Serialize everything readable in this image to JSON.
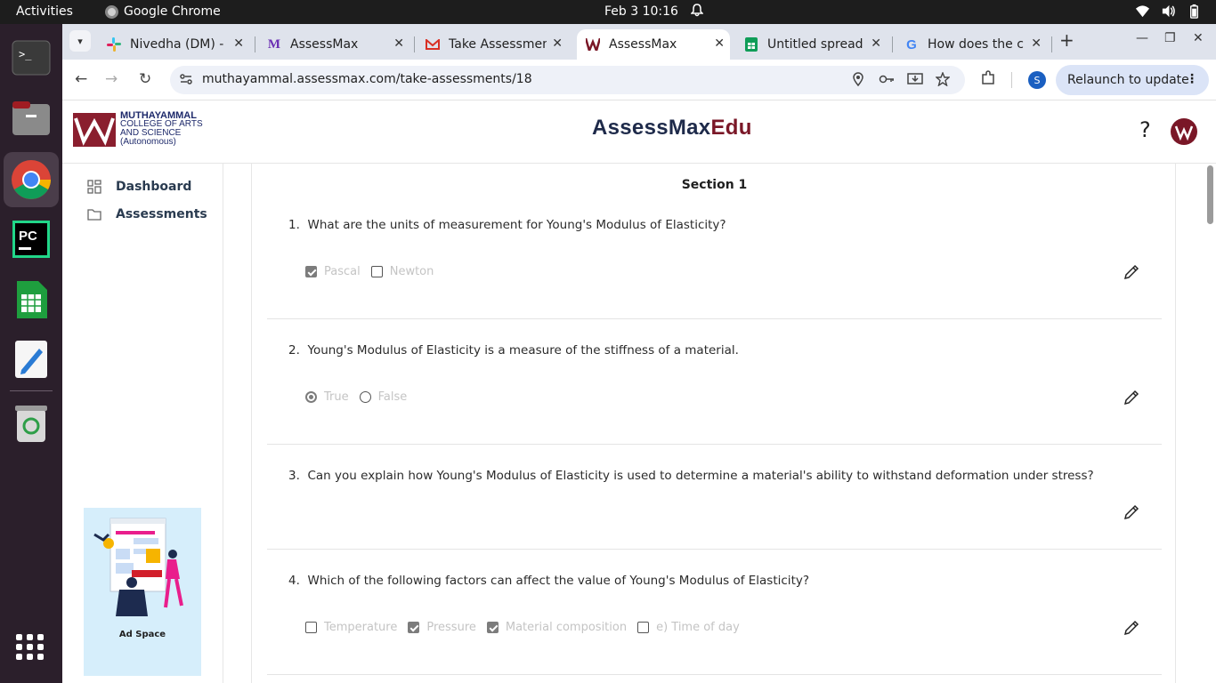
{
  "topbar": {
    "activities": "Activities",
    "app_name": "Google Chrome",
    "clock": "Feb 3  10:16"
  },
  "dock": {
    "apps": [
      "terminal-icon",
      "files-icon",
      "chrome-icon",
      "pycharm-icon",
      "spreadsheet-icon",
      "text-editor-icon",
      "trash-icon"
    ]
  },
  "tabs": [
    {
      "label": "Nivedha (DM) - y",
      "icon": "slack-icon",
      "active": false
    },
    {
      "label": "AssessMax",
      "icon": "assessmax-m-icon",
      "active": false
    },
    {
      "label": "Take Assessmen",
      "icon": "gmail-icon",
      "active": false
    },
    {
      "label": "AssessMax",
      "icon": "assessmax-logo-icon",
      "active": true
    },
    {
      "label": "Untitled spread",
      "icon": "sheets-icon",
      "active": false
    },
    {
      "label": "How does the c",
      "icon": "google-icon",
      "active": false
    }
  ],
  "toolbar": {
    "url": "muthayammal.assessmax.com/take-assessments/18",
    "profile_initial": "S",
    "relaunch_label": "Relaunch to update"
  },
  "header": {
    "logo_line1": "MUTHAYAMMAL",
    "logo_line2": "COLLEGE OF ARTS",
    "logo_line3": "AND SCIENCE",
    "logo_line4": "(Autonomous)",
    "brand_part1": "AssessMax",
    "brand_part2": "Edu",
    "help": "?"
  },
  "sidebar": {
    "items": [
      {
        "label": "Dashboard",
        "icon": "dashboard-grid-icon"
      },
      {
        "label": "Assessments",
        "icon": "folder-icon"
      }
    ],
    "ad_label": "Ad Space"
  },
  "main": {
    "section_title": "Section 1",
    "questions": [
      {
        "number": "1.",
        "text": "What are the units of measurement for Young's Modulus of Elasticity?",
        "type": "checkbox",
        "options": [
          {
            "label": "Pascal",
            "checked": true
          },
          {
            "label": "Newton",
            "checked": false
          }
        ]
      },
      {
        "number": "2.",
        "text": "Young's Modulus of Elasticity is a measure of the stiffness of a material.",
        "type": "radio",
        "options": [
          {
            "label": "True",
            "checked": true
          },
          {
            "label": "False",
            "checked": false
          }
        ]
      },
      {
        "number": "3.",
        "text": "Can you explain how Young's Modulus of Elasticity is used to determine a material's ability to withstand deformation under stress?",
        "type": "text",
        "options": []
      },
      {
        "number": "4.",
        "text": "Which of the following factors can affect the value of Young's Modulus of Elasticity?",
        "type": "checkbox",
        "options": [
          {
            "label": "Temperature",
            "checked": false
          },
          {
            "label": "Pressure",
            "checked": true
          },
          {
            "label": "Material composition",
            "checked": true
          },
          {
            "label": "e) Time of day",
            "checked": false
          }
        ]
      }
    ]
  }
}
